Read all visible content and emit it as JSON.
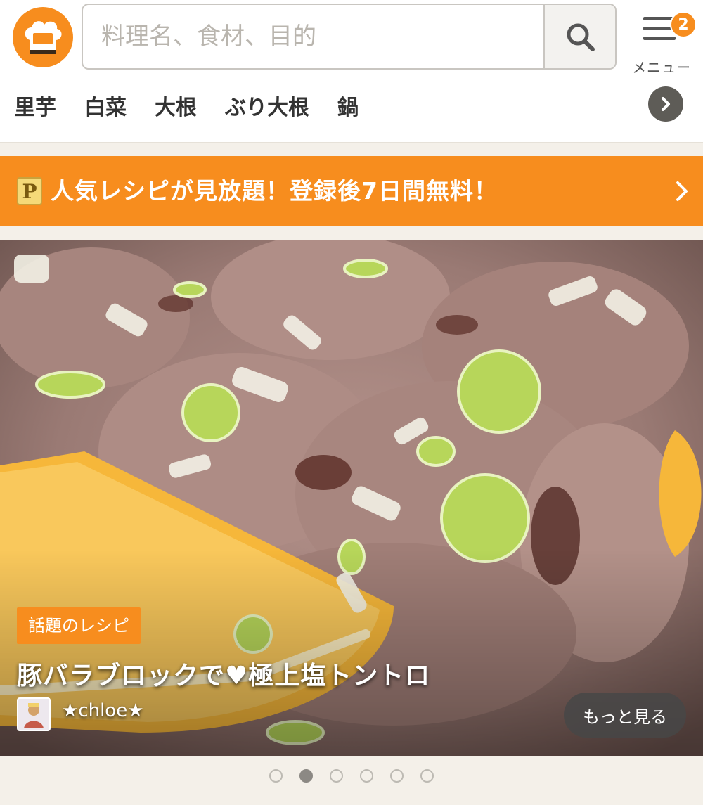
{
  "search": {
    "placeholder": "料理名、食材、目的"
  },
  "menu": {
    "label": "メニュー",
    "badge_count": "2"
  },
  "keywords": [
    "里芋",
    "白菜",
    "大根",
    "ぶり大根",
    "鍋"
  ],
  "banner": {
    "icon_letter": "P",
    "text": "人気レシピが見放題！登録後7日間無料！"
  },
  "hero": {
    "tag": "話題のレシピ",
    "title": "豚バラブロックで♥極上塩トントロ",
    "author": "★chloe★",
    "more_label": "もっと見る"
  },
  "carousel": {
    "total": 6,
    "active_index": 1
  },
  "colors": {
    "accent": "#f78d1e",
    "text": "#333333"
  }
}
